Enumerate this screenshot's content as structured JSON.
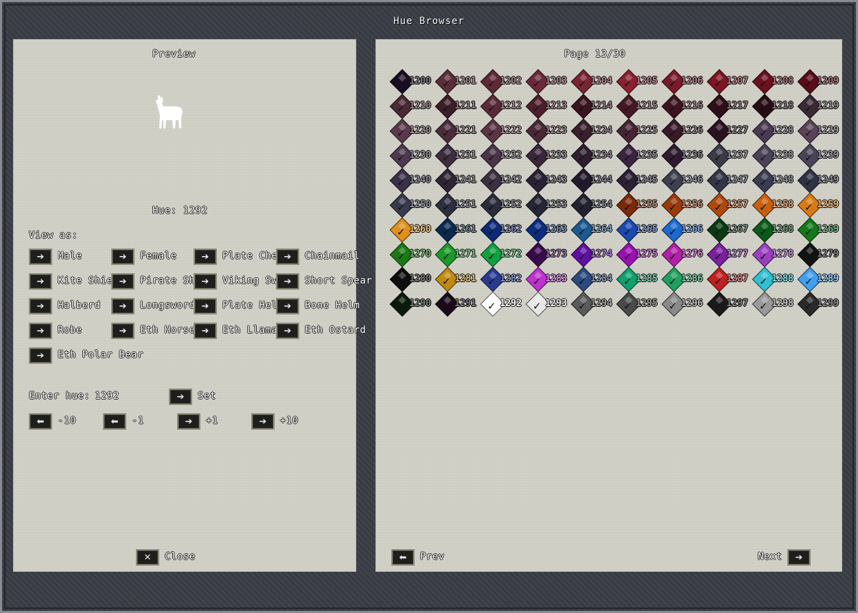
{
  "window": {
    "title": "Hue Browser"
  },
  "preview": {
    "heading": "Preview",
    "hue_label": "Hue:",
    "hue_value": "1292",
    "figure": "llama-icon"
  },
  "view_as": {
    "label": "View as:",
    "options": [
      "Male",
      "Female",
      "Plate Chest",
      "Chainmail",
      "Kite Shield",
      "Pirate Shield",
      "Viking Sword",
      "Short Spear",
      "Halberd",
      "Longsword",
      "Plate Helm",
      "Bone Helm",
      "Robe",
      "Eth Horse",
      "Eth Llama",
      "Eth Ostard",
      "Eth Polar Bear"
    ]
  },
  "enter_hue": {
    "label": "Enter hue:",
    "value": "1292",
    "set_label": "Set"
  },
  "steps": [
    "-10",
    "-1",
    "+1",
    "+10"
  ],
  "close_label": "Close",
  "page": {
    "label": "Page",
    "current": "13",
    "total": "30"
  },
  "nav": {
    "prev_label": "Prev",
    "next_label": "Next"
  },
  "swatches": [
    {
      "n": "1200",
      "c": "#1a0e22"
    },
    {
      "n": "1201",
      "c": "#5a2e38"
    },
    {
      "n": "1202",
      "c": "#5e2a36"
    },
    {
      "n": "1203",
      "c": "#6a2a3a"
    },
    {
      "n": "1204",
      "c": "#7a2434"
    },
    {
      "n": "1205",
      "c": "#8a2030"
    },
    {
      "n": "1206",
      "c": "#7a1a2a"
    },
    {
      "n": "1207",
      "c": "#7e1424"
    },
    {
      "n": "1208",
      "c": "#6c1020"
    },
    {
      "n": "1209",
      "c": "#5a0c18"
    },
    {
      "n": "1210",
      "c": "#4a2a34"
    },
    {
      "n": "1211",
      "c": "#3c1e28"
    },
    {
      "n": "1212",
      "c": "#5a2a38"
    },
    {
      "n": "1213",
      "c": "#4e1e2c"
    },
    {
      "n": "1214",
      "c": "#3a1420"
    },
    {
      "n": "1215",
      "c": "#461824"
    },
    {
      "n": "1216",
      "c": "#3e1420"
    },
    {
      "n": "1217",
      "c": "#2e0e18"
    },
    {
      "n": "1218",
      "c": "#260c14"
    },
    {
      "n": "1219",
      "c": "#3a2a36"
    },
    {
      "n": "1220",
      "c": "#5a3a4a"
    },
    {
      "n": "1221",
      "c": "#4a2c3a"
    },
    {
      "n": "1222",
      "c": "#5c3444"
    },
    {
      "n": "1223",
      "c": "#4a2838"
    },
    {
      "n": "1224",
      "c": "#3a1e2c"
    },
    {
      "n": "1225",
      "c": "#462434"
    },
    {
      "n": "1226",
      "c": "#381a28"
    },
    {
      "n": "1227",
      "c": "#2a1220"
    },
    {
      "n": "1228",
      "c": "#4a3a52"
    },
    {
      "n": "1229",
      "c": "#5a4258"
    },
    {
      "n": "1230",
      "c": "#4e3a50"
    },
    {
      "n": "1231",
      "c": "#3e2c40"
    },
    {
      "n": "1232",
      "c": "#4a3448"
    },
    {
      "n": "1233",
      "c": "#3a283a"
    },
    {
      "n": "1234",
      "c": "#2e1e30"
    },
    {
      "n": "1235",
      "c": "#3a2440"
    },
    {
      "n": "1236",
      "c": "#2e1a30"
    },
    {
      "n": "1237",
      "c": "#3a3a48"
    },
    {
      "n": "1238",
      "c": "#4a4258"
    },
    {
      "n": "1239",
      "c": "#4a4458"
    },
    {
      "n": "1240",
      "c": "#3a3048"
    },
    {
      "n": "1241",
      "c": "#2e2636"
    },
    {
      "n": "1242",
      "c": "#3a3040"
    },
    {
      "n": "1243",
      "c": "#2a2234"
    },
    {
      "n": "1244",
      "c": "#221a2c"
    },
    {
      "n": "1245",
      "c": "#2c2036"
    },
    {
      "n": "1246",
      "c": "#3e4050"
    },
    {
      "n": "1247",
      "c": "#343648"
    },
    {
      "n": "1248",
      "c": "#3a3c52"
    },
    {
      "n": "1249",
      "c": "#303246"
    },
    {
      "n": "1250",
      "c": "#3a3a4e"
    },
    {
      "n": "1251",
      "c": "#2e2e40"
    },
    {
      "n": "1252",
      "c": "#2c2c3c"
    },
    {
      "n": "1253",
      "c": "#262636"
    },
    {
      "n": "1254",
      "c": "#222230"
    },
    {
      "n": "1255",
      "c": "#7a2a08"
    },
    {
      "n": "1256",
      "c": "#9a3a0a"
    },
    {
      "n": "1257",
      "c": "#b04a0c"
    },
    {
      "n": "1258",
      "c": "#c86010"
    },
    {
      "n": "1259",
      "c": "#d87a14"
    },
    {
      "n": "1260",
      "c": "#e0901a"
    },
    {
      "n": "1261",
      "c": "#0a2a50"
    },
    {
      "n": "1262",
      "c": "#0c2a78"
    },
    {
      "n": "1263",
      "c": "#0a2c80"
    },
    {
      "n": "1264",
      "c": "#1a5a90"
    },
    {
      "n": "1265",
      "c": "#1a4ab0"
    },
    {
      "n": "1266",
      "c": "#1a6ad0"
    },
    {
      "n": "1267",
      "c": "#0a3a12"
    },
    {
      "n": "1268",
      "c": "#0a5a1a"
    },
    {
      "n": "1269",
      "c": "#127a1a"
    },
    {
      "n": "1270",
      "c": "#1a7a12"
    },
    {
      "n": "1271",
      "c": "#1a9a2a"
    },
    {
      "n": "1272",
      "c": "#10a040"
    },
    {
      "n": "1273",
      "c": "#3a0a50"
    },
    {
      "n": "1274",
      "c": "#6010a0"
    },
    {
      "n": "1275",
      "c": "#9a10b0"
    },
    {
      "n": "1276",
      "c": "#b020a8"
    },
    {
      "n": "1277",
      "c": "#7a20a0"
    },
    {
      "n": "1278",
      "c": "#9a40c0"
    },
    {
      "n": "1279",
      "c": "#121212"
    },
    {
      "n": "1280",
      "c": "#0e0e0e"
    },
    {
      "n": "1281",
      "c": "#c08a10"
    },
    {
      "n": "1282",
      "c": "#2a3a90"
    },
    {
      "n": "1283",
      "c": "#c030d0"
    },
    {
      "n": "1284",
      "c": "#2a4a80"
    },
    {
      "n": "1285",
      "c": "#10a070"
    },
    {
      "n": "1286",
      "c": "#20a060"
    },
    {
      "n": "1287",
      "c": "#c02020"
    },
    {
      "n": "1288",
      "c": "#30c0d0"
    },
    {
      "n": "1289",
      "c": "#40a0f0"
    },
    {
      "n": "1290",
      "c": "#0a1a0a"
    },
    {
      "n": "1291",
      "c": "#1a0a1a"
    },
    {
      "n": "1292",
      "c": "#ffffff"
    },
    {
      "n": "1293",
      "c": "#e8e8e8"
    },
    {
      "n": "1294",
      "c": "#5a5a5a"
    },
    {
      "n": "1295",
      "c": "#4a4a4a"
    },
    {
      "n": "1296",
      "c": "#8a8a8a"
    },
    {
      "n": "1297",
      "c": "#1a1a1a"
    },
    {
      "n": "1298",
      "c": "#9a9a9a"
    },
    {
      "n": "1299",
      "c": "#2a2a2a"
    }
  ]
}
